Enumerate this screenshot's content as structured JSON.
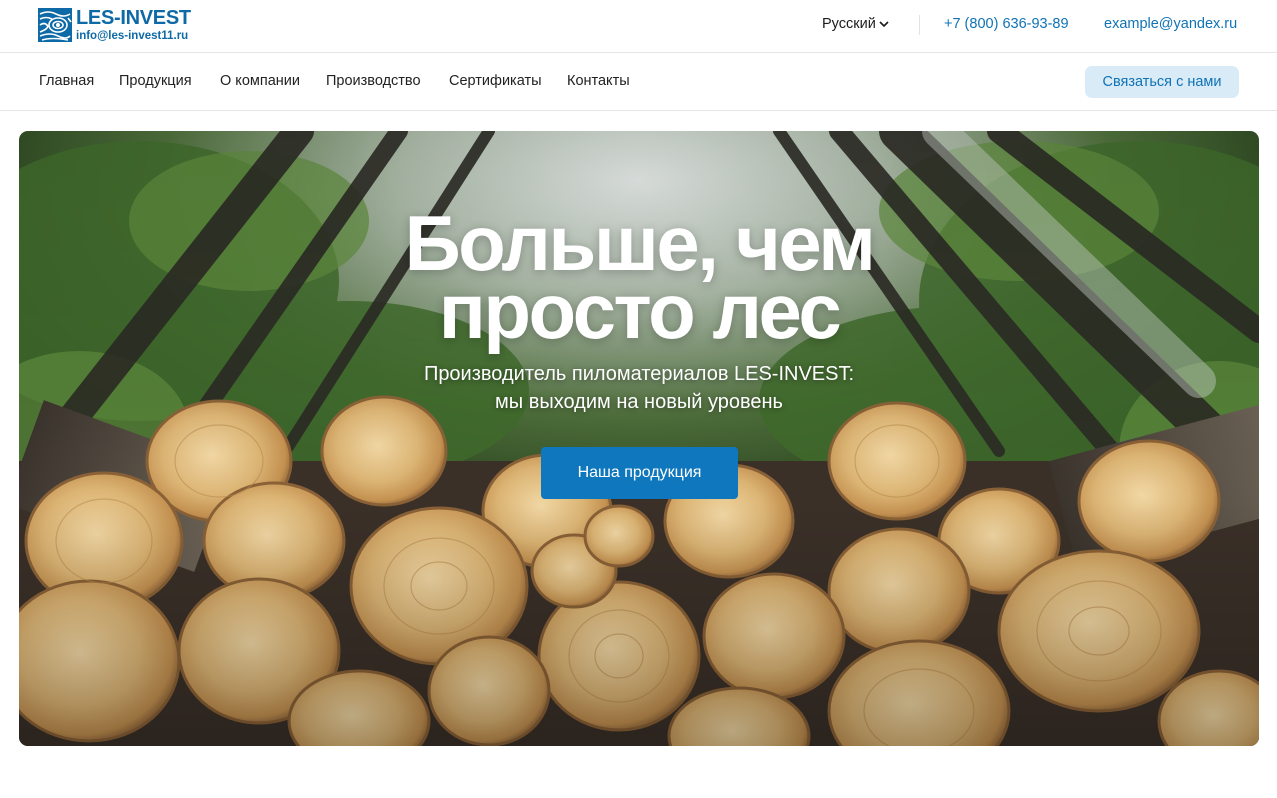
{
  "brand": {
    "name": "LES-INVEST",
    "email": "info@les-invest11.ru",
    "logo_icon": "wood-rings-logo-icon",
    "color": "#0e6aa6"
  },
  "header": {
    "language": "Русский",
    "language_icon": "chevron-down-icon",
    "phone": "+7 (800) 636-93-89",
    "email": "example@yandex.ru",
    "link_color": "#0f73b6"
  },
  "nav": {
    "items": [
      {
        "label": "Главная"
      },
      {
        "label": "Продукция"
      },
      {
        "label": "О компании"
      },
      {
        "label": "Производство"
      },
      {
        "label": "Сертификаты"
      },
      {
        "label": "Контакты"
      }
    ],
    "contact_button": "Связаться с нами"
  },
  "hero": {
    "title_line1": "Больше, чем",
    "title_line2": "просто лес",
    "subtitle_line1": "Производитель пиломатериалов LES-INVEST:",
    "subtitle_line2": "мы выходим на новый уровень",
    "cta": "Наша продукция",
    "cta_color": "#0f77bd",
    "image": "forest-and-log-pile-photo"
  }
}
